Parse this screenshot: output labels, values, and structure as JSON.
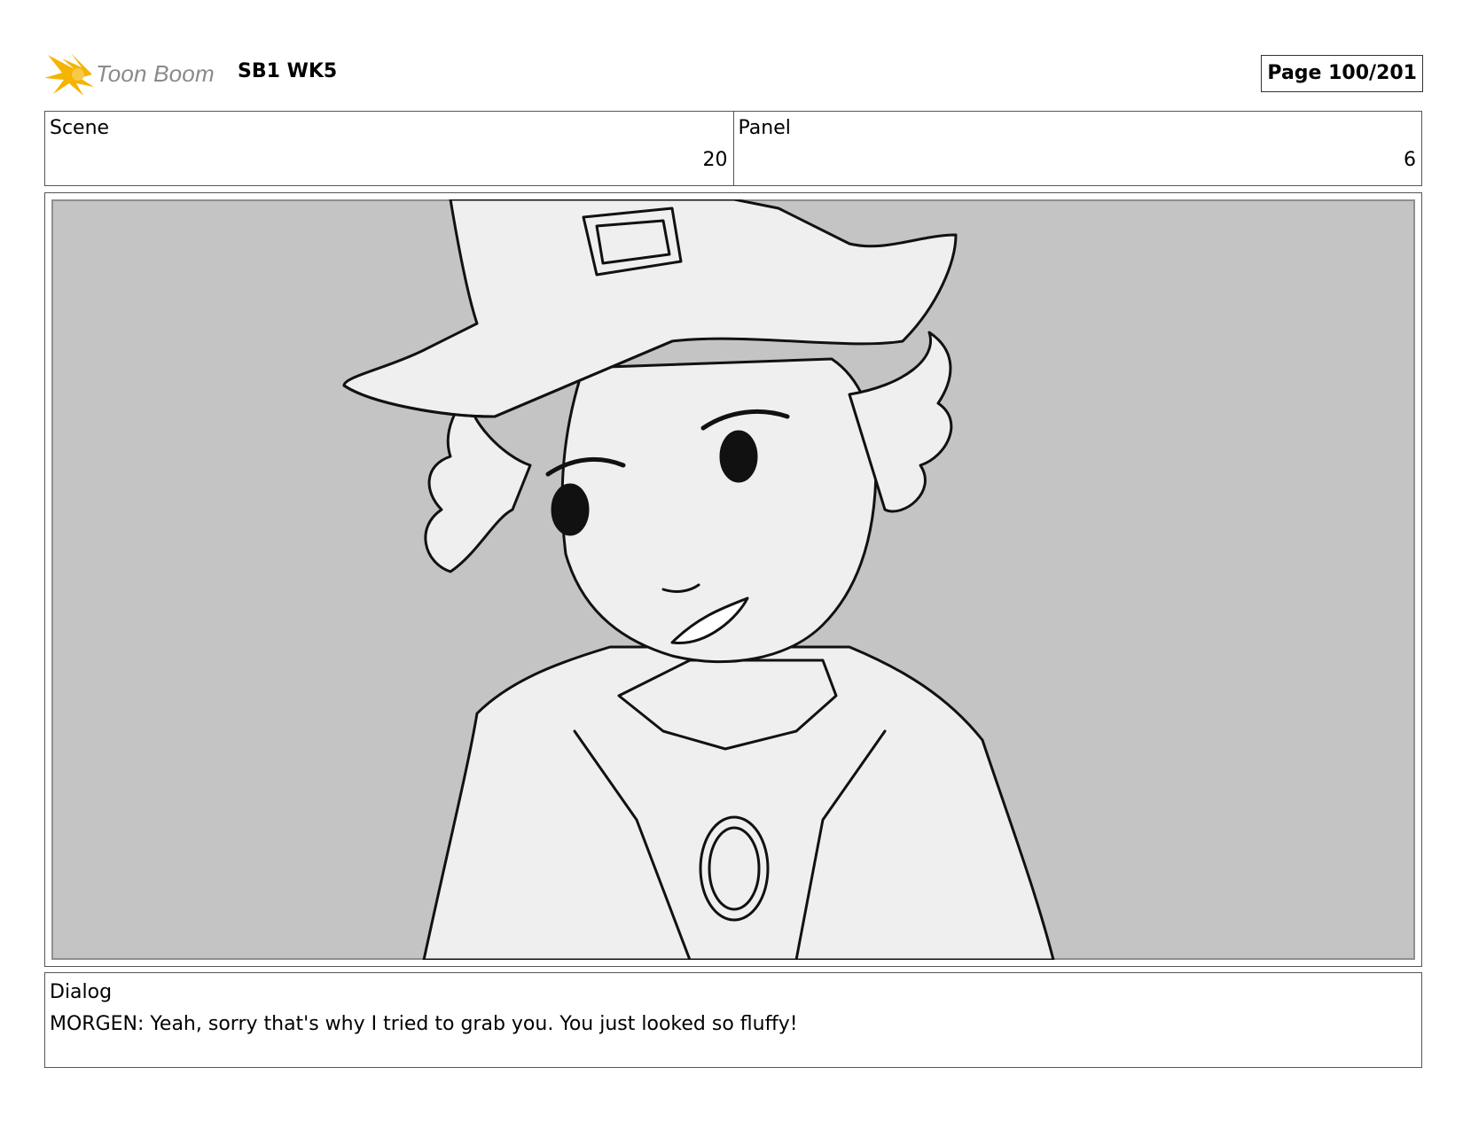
{
  "header": {
    "logo_text": "Toon Boom",
    "project": "SB1 WK5",
    "page": "Page 100/201"
  },
  "info": {
    "scene_label": "Scene",
    "scene_value": "20",
    "panel_label": "Panel",
    "panel_value": "6"
  },
  "dialog": {
    "label": "Dialog",
    "text": "MORGEN: Yeah, sorry that's why I tried to grab you. You just looked so fluffy!"
  },
  "colors": {
    "panel_background": "#c4c4c4",
    "figure_fill": "#efefef",
    "line": "#111111",
    "logo_accent": "#f4b400"
  }
}
